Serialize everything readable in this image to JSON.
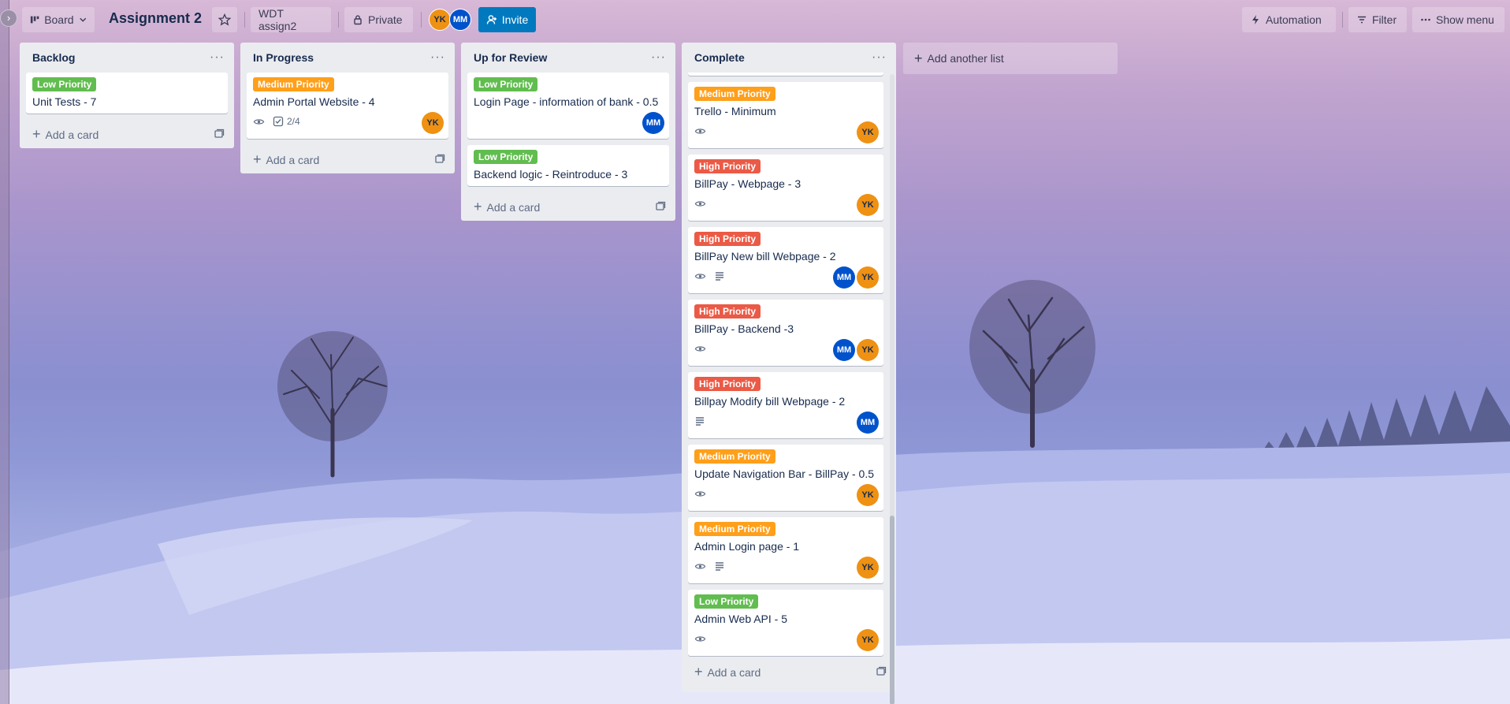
{
  "header": {
    "view_label": "Board",
    "board_title": "Assignment 2",
    "workspace_label": "WDT assign2",
    "visibility_label": "Private",
    "members": [
      "YK",
      "MM"
    ],
    "invite_label": "Invite",
    "automation_label": "Automation",
    "filter_label": "Filter",
    "show_menu_label": "Show menu"
  },
  "lists": [
    {
      "title": "Backlog",
      "cards": [
        {
          "label": "Low Priority",
          "title": "Unit Tests - 7"
        }
      ],
      "add_card": "Add a card"
    },
    {
      "title": "In Progress",
      "cards": [
        {
          "label": "Medium Priority",
          "title": "Admin Portal Website - 4",
          "checklist": "2/4",
          "members": [
            "YK"
          ]
        }
      ],
      "add_card": "Add a card"
    },
    {
      "title": "Up for Review",
      "cards": [
        {
          "label": "Low Priority",
          "title": "Login Page - information of bank - 0.5",
          "members": [
            "MM"
          ]
        },
        {
          "label": "Low Priority",
          "title": "Backend logic - Reintroduce - 3"
        }
      ],
      "add_card": "Add a card"
    },
    {
      "title": "Complete",
      "cards": [
        {
          "label": "Medium Priority",
          "title": "Trello - Minimum",
          "members": [
            "YK"
          ]
        },
        {
          "label": "High Priority",
          "title": "BillPay - Webpage - 3",
          "members": [
            "YK"
          ]
        },
        {
          "label": "High Priority",
          "title": "BillPay New bill Webpage - 2",
          "members": [
            "MM",
            "YK"
          ]
        },
        {
          "label": "High Priority",
          "title": "BillPay - Backend -3",
          "members": [
            "MM",
            "YK"
          ]
        },
        {
          "label": "High Priority",
          "title": "Billpay Modify bill Webpage - 2",
          "members": [
            "MM"
          ]
        },
        {
          "label": "Medium Priority",
          "title": "Update Navigation Bar - BillPay - 0.5",
          "members": [
            "YK"
          ]
        },
        {
          "label": "Medium Priority",
          "title": "Admin Login page - 1",
          "members": [
            "YK"
          ]
        },
        {
          "label": "Low Priority",
          "title": "Admin Web API - 5",
          "members": [
            "YK"
          ]
        }
      ],
      "add_card": "Add a card"
    }
  ],
  "add_list_label": "Add another list",
  "colors": {
    "low": "#61bd4f",
    "medium": "#ff9f1a",
    "high": "#eb5a46",
    "invite": "#0079bf",
    "avatar_yk": "#ef9113",
    "avatar_mm": "#0052cc"
  }
}
